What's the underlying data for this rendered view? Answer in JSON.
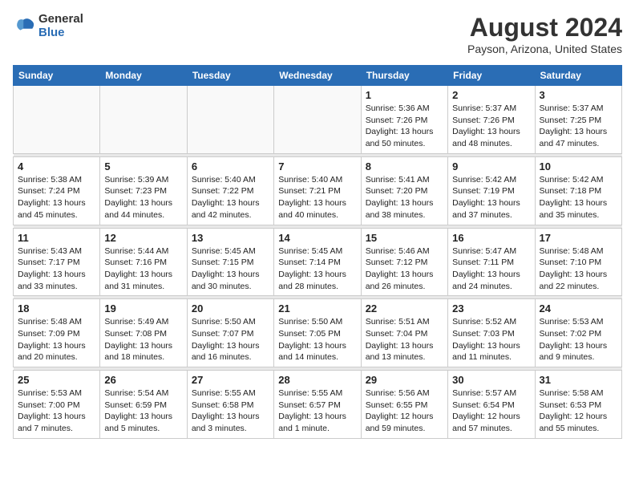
{
  "logo": {
    "general": "General",
    "blue": "Blue"
  },
  "title": "August 2024",
  "location": "Payson, Arizona, United States",
  "days_of_week": [
    "Sunday",
    "Monday",
    "Tuesday",
    "Wednesday",
    "Thursday",
    "Friday",
    "Saturday"
  ],
  "weeks": [
    [
      {
        "day": "",
        "info": ""
      },
      {
        "day": "",
        "info": ""
      },
      {
        "day": "",
        "info": ""
      },
      {
        "day": "",
        "info": ""
      },
      {
        "day": "1",
        "info": "Sunrise: 5:36 AM\nSunset: 7:26 PM\nDaylight: 13 hours\nand 50 minutes."
      },
      {
        "day": "2",
        "info": "Sunrise: 5:37 AM\nSunset: 7:26 PM\nDaylight: 13 hours\nand 48 minutes."
      },
      {
        "day": "3",
        "info": "Sunrise: 5:37 AM\nSunset: 7:25 PM\nDaylight: 13 hours\nand 47 minutes."
      }
    ],
    [
      {
        "day": "4",
        "info": "Sunrise: 5:38 AM\nSunset: 7:24 PM\nDaylight: 13 hours\nand 45 minutes."
      },
      {
        "day": "5",
        "info": "Sunrise: 5:39 AM\nSunset: 7:23 PM\nDaylight: 13 hours\nand 44 minutes."
      },
      {
        "day": "6",
        "info": "Sunrise: 5:40 AM\nSunset: 7:22 PM\nDaylight: 13 hours\nand 42 minutes."
      },
      {
        "day": "7",
        "info": "Sunrise: 5:40 AM\nSunset: 7:21 PM\nDaylight: 13 hours\nand 40 minutes."
      },
      {
        "day": "8",
        "info": "Sunrise: 5:41 AM\nSunset: 7:20 PM\nDaylight: 13 hours\nand 38 minutes."
      },
      {
        "day": "9",
        "info": "Sunrise: 5:42 AM\nSunset: 7:19 PM\nDaylight: 13 hours\nand 37 minutes."
      },
      {
        "day": "10",
        "info": "Sunrise: 5:42 AM\nSunset: 7:18 PM\nDaylight: 13 hours\nand 35 minutes."
      }
    ],
    [
      {
        "day": "11",
        "info": "Sunrise: 5:43 AM\nSunset: 7:17 PM\nDaylight: 13 hours\nand 33 minutes."
      },
      {
        "day": "12",
        "info": "Sunrise: 5:44 AM\nSunset: 7:16 PM\nDaylight: 13 hours\nand 31 minutes."
      },
      {
        "day": "13",
        "info": "Sunrise: 5:45 AM\nSunset: 7:15 PM\nDaylight: 13 hours\nand 30 minutes."
      },
      {
        "day": "14",
        "info": "Sunrise: 5:45 AM\nSunset: 7:14 PM\nDaylight: 13 hours\nand 28 minutes."
      },
      {
        "day": "15",
        "info": "Sunrise: 5:46 AM\nSunset: 7:12 PM\nDaylight: 13 hours\nand 26 minutes."
      },
      {
        "day": "16",
        "info": "Sunrise: 5:47 AM\nSunset: 7:11 PM\nDaylight: 13 hours\nand 24 minutes."
      },
      {
        "day": "17",
        "info": "Sunrise: 5:48 AM\nSunset: 7:10 PM\nDaylight: 13 hours\nand 22 minutes."
      }
    ],
    [
      {
        "day": "18",
        "info": "Sunrise: 5:48 AM\nSunset: 7:09 PM\nDaylight: 13 hours\nand 20 minutes."
      },
      {
        "day": "19",
        "info": "Sunrise: 5:49 AM\nSunset: 7:08 PM\nDaylight: 13 hours\nand 18 minutes."
      },
      {
        "day": "20",
        "info": "Sunrise: 5:50 AM\nSunset: 7:07 PM\nDaylight: 13 hours\nand 16 minutes."
      },
      {
        "day": "21",
        "info": "Sunrise: 5:50 AM\nSunset: 7:05 PM\nDaylight: 13 hours\nand 14 minutes."
      },
      {
        "day": "22",
        "info": "Sunrise: 5:51 AM\nSunset: 7:04 PM\nDaylight: 13 hours\nand 13 minutes."
      },
      {
        "day": "23",
        "info": "Sunrise: 5:52 AM\nSunset: 7:03 PM\nDaylight: 13 hours\nand 11 minutes."
      },
      {
        "day": "24",
        "info": "Sunrise: 5:53 AM\nSunset: 7:02 PM\nDaylight: 13 hours\nand 9 minutes."
      }
    ],
    [
      {
        "day": "25",
        "info": "Sunrise: 5:53 AM\nSunset: 7:00 PM\nDaylight: 13 hours\nand 7 minutes."
      },
      {
        "day": "26",
        "info": "Sunrise: 5:54 AM\nSunset: 6:59 PM\nDaylight: 13 hours\nand 5 minutes."
      },
      {
        "day": "27",
        "info": "Sunrise: 5:55 AM\nSunset: 6:58 PM\nDaylight: 13 hours\nand 3 minutes."
      },
      {
        "day": "28",
        "info": "Sunrise: 5:55 AM\nSunset: 6:57 PM\nDaylight: 13 hours\nand 1 minute."
      },
      {
        "day": "29",
        "info": "Sunrise: 5:56 AM\nSunset: 6:55 PM\nDaylight: 12 hours\nand 59 minutes."
      },
      {
        "day": "30",
        "info": "Sunrise: 5:57 AM\nSunset: 6:54 PM\nDaylight: 12 hours\nand 57 minutes."
      },
      {
        "day": "31",
        "info": "Sunrise: 5:58 AM\nSunset: 6:53 PM\nDaylight: 12 hours\nand 55 minutes."
      }
    ]
  ]
}
